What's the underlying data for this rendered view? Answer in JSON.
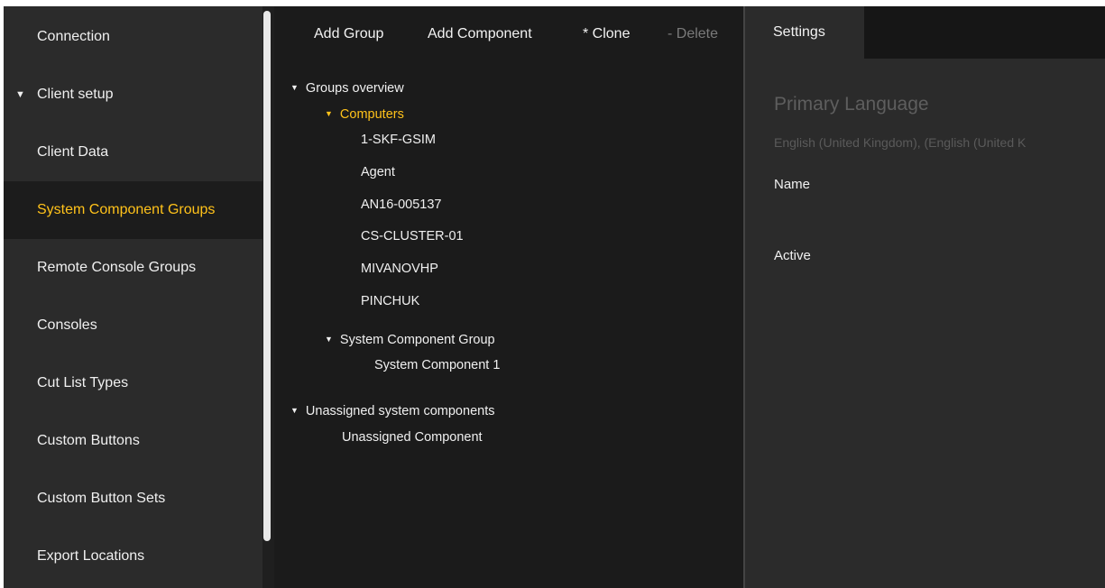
{
  "sidebar": {
    "items": [
      {
        "label": "Connection"
      },
      {
        "label": "Client setup",
        "expanded": true
      },
      {
        "label": "Client Data"
      },
      {
        "label": "System Component Groups",
        "selected": true
      },
      {
        "label": "Remote Console Groups"
      },
      {
        "label": "Consoles"
      },
      {
        "label": "Cut List Types"
      },
      {
        "label": "Custom Buttons"
      },
      {
        "label": "Custom Button Sets"
      },
      {
        "label": "Export Locations"
      }
    ],
    "caret_icon": "triangle-down-icon"
  },
  "toolbar": {
    "add_group": "Add Group",
    "add_component": "Add Component",
    "clone": "* Clone",
    "delete": "- Delete"
  },
  "tree": {
    "groups_overview": "Groups overview",
    "computers": "Computers",
    "computers_items": [
      "1-SKF-GSIM",
      "Agent",
      "AN16-005137",
      "CS-CLUSTER-01",
      "MIVANOVHP",
      "PINCHUK"
    ],
    "system_component_group": "System Component Group",
    "system_component_group_items": [
      "System Component 1"
    ],
    "unassigned": "Unassigned system components",
    "unassigned_items": [
      "Unassigned Component"
    ]
  },
  "settings": {
    "tab_label": "Settings",
    "section_title": "Primary Language",
    "section_subtitle": "English (United Kingdom), (English (United K",
    "name_label": "Name",
    "active_label": "Active"
  },
  "colors": {
    "accent": "#ffc21a",
    "sidebar_bg": "#2b2b2b",
    "panel_bg": "#1b1b1b"
  }
}
